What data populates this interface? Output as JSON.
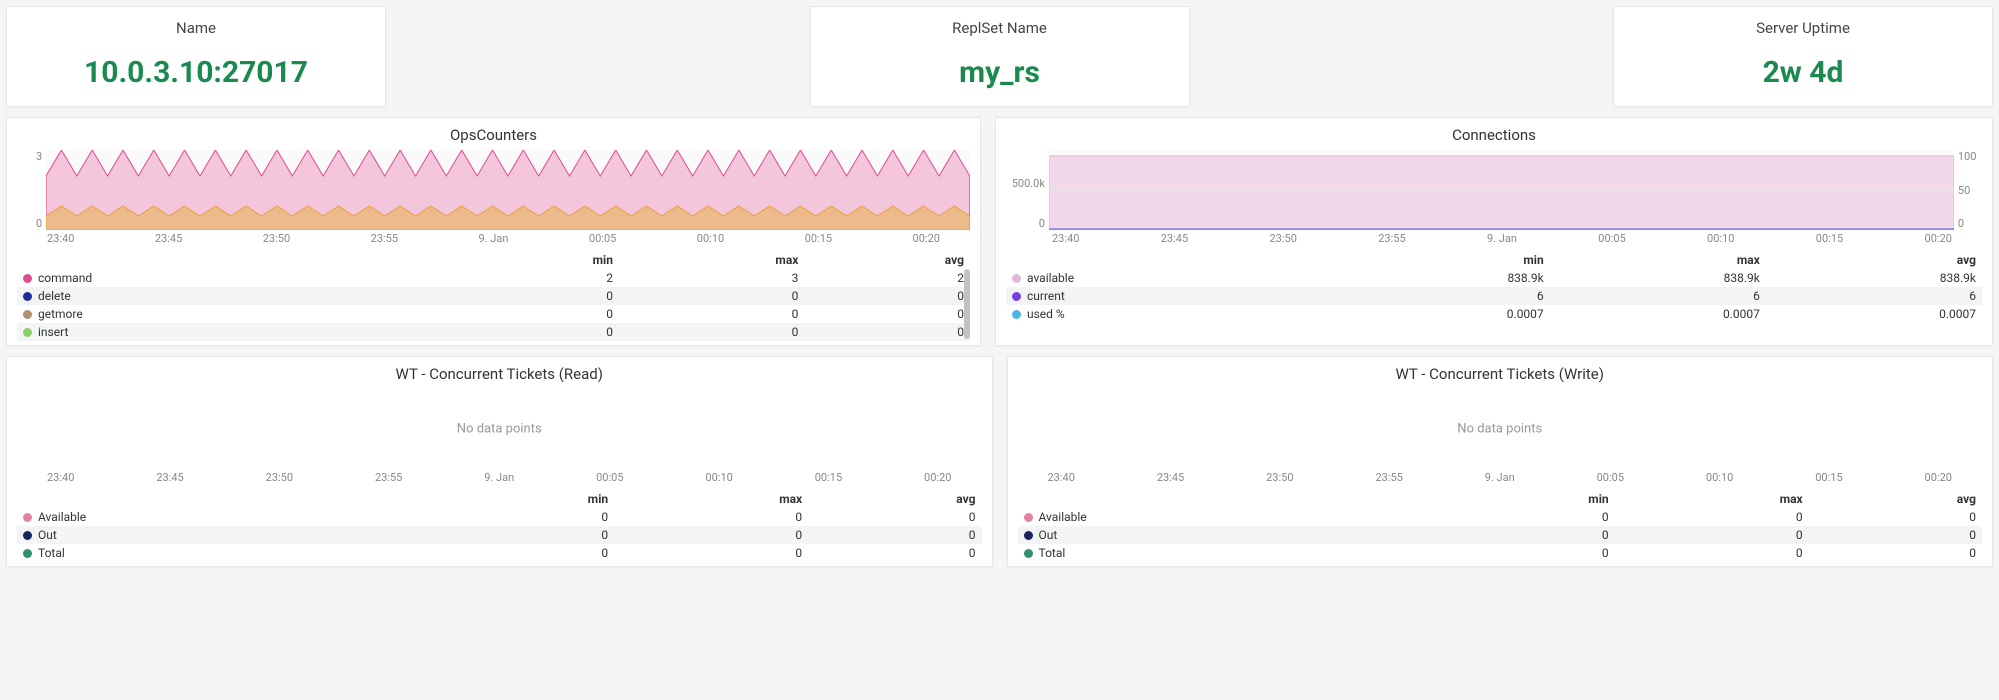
{
  "stats": {
    "name_label": "Name",
    "name_value": "10.0.3.10:27017",
    "replset_label": "ReplSet Name",
    "replset_value": "my_rs",
    "uptime_label": "Server Uptime",
    "uptime_value": "2w 4d"
  },
  "time_ticks": [
    "23:40",
    "23:45",
    "23:50",
    "23:55",
    "9. Jan",
    "00:05",
    "00:10",
    "00:15",
    "00:20"
  ],
  "table_headers": {
    "min": "min",
    "max": "max",
    "avg": "avg"
  },
  "nodata_text": "No data points",
  "panels": {
    "ops": {
      "title": "OpsCounters",
      "y_ticks": [
        "3",
        "0"
      ],
      "legend": [
        {
          "color": "#e24d8e",
          "label": "command",
          "min": "2",
          "max": "3",
          "avg": "2"
        },
        {
          "color": "#1f2f98",
          "label": "delete",
          "min": "0",
          "max": "0",
          "avg": "0"
        },
        {
          "color": "#b08f6f",
          "label": "getmore",
          "min": "0",
          "max": "0",
          "avg": "0"
        },
        {
          "color": "#8bd06b",
          "label": "insert",
          "min": "0",
          "max": "0",
          "avg": "0"
        }
      ]
    },
    "conn": {
      "title": "Connections",
      "y_left": [
        "",
        "500.0k",
        "0"
      ],
      "y_right": [
        "100",
        "50",
        "0"
      ],
      "legend": [
        {
          "color": "#e6b6d6",
          "label": "available",
          "min": "838.9k",
          "max": "838.9k",
          "avg": "838.9k"
        },
        {
          "color": "#7b3fe4",
          "label": "current",
          "min": "6",
          "max": "6",
          "avg": "6"
        },
        {
          "color": "#4fb3e8",
          "label": "used %",
          "min": "0.0007",
          "max": "0.0007",
          "avg": "0.0007"
        }
      ]
    },
    "wt_read": {
      "title": "WT - Concurrent Tickets (Read)",
      "legend": [
        {
          "color": "#e6829f",
          "label": "Available",
          "min": "0",
          "max": "0",
          "avg": "0"
        },
        {
          "color": "#18225e",
          "label": "Out",
          "min": "0",
          "max": "0",
          "avg": "0"
        },
        {
          "color": "#2f8f6f",
          "label": "Total",
          "min": "0",
          "max": "0",
          "avg": "0"
        }
      ]
    },
    "wt_write": {
      "title": "WT - Concurrent Tickets (Write)",
      "legend": [
        {
          "color": "#e6829f",
          "label": "Available",
          "min": "0",
          "max": "0",
          "avg": "0"
        },
        {
          "color": "#18225e",
          "label": "Out",
          "min": "0",
          "max": "0",
          "avg": "0"
        },
        {
          "color": "#2f8f6f",
          "label": "Total",
          "min": "0",
          "max": "0",
          "avg": "0"
        }
      ]
    }
  },
  "chart_data": [
    {
      "type": "area",
      "title": "OpsCounters",
      "xlabel": "",
      "ylabel": "",
      "ylim": [
        0,
        3
      ],
      "x": [
        "23:40",
        "23:45",
        "23:50",
        "23:55",
        "9. Jan",
        "00:05",
        "00:10",
        "00:15",
        "00:20"
      ],
      "series": [
        {
          "name": "command",
          "values_approx": "oscillates between 2 and 3",
          "min": 2,
          "max": 3,
          "avg": 2
        },
        {
          "name": "delete",
          "min": 0,
          "max": 0,
          "avg": 0
        },
        {
          "name": "getmore",
          "min": 0,
          "max": 0,
          "avg": 0
        },
        {
          "name": "insert",
          "min": 0,
          "max": 0,
          "avg": 0
        }
      ]
    },
    {
      "type": "area",
      "title": "Connections",
      "xlabel": "",
      "ylabel": "",
      "ylim_left": [
        0,
        1000000
      ],
      "ylim_right": [
        0,
        100
      ],
      "x": [
        "23:40",
        "23:45",
        "23:50",
        "23:55",
        "9. Jan",
        "00:05",
        "00:10",
        "00:15",
        "00:20"
      ],
      "series": [
        {
          "name": "available",
          "min": 838900,
          "max": 838900,
          "avg": 838900,
          "axis": "left"
        },
        {
          "name": "current",
          "min": 6,
          "max": 6,
          "avg": 6,
          "axis": "left"
        },
        {
          "name": "used %",
          "min": 0.0007,
          "max": 0.0007,
          "avg": 0.0007,
          "axis": "right"
        }
      ]
    },
    {
      "type": "line",
      "title": "WT - Concurrent Tickets (Read)",
      "x": [
        "23:40",
        "23:45",
        "23:50",
        "23:55",
        "9. Jan",
        "00:05",
        "00:10",
        "00:15",
        "00:20"
      ],
      "series": [
        {
          "name": "Available",
          "min": 0,
          "max": 0,
          "avg": 0
        },
        {
          "name": "Out",
          "min": 0,
          "max": 0,
          "avg": 0
        },
        {
          "name": "Total",
          "min": 0,
          "max": 0,
          "avg": 0
        }
      ],
      "note": "No data points"
    },
    {
      "type": "line",
      "title": "WT - Concurrent Tickets (Write)",
      "x": [
        "23:40",
        "23:45",
        "23:50",
        "23:55",
        "9. Jan",
        "00:05",
        "00:10",
        "00:15",
        "00:20"
      ],
      "series": [
        {
          "name": "Available",
          "min": 0,
          "max": 0,
          "avg": 0
        },
        {
          "name": "Out",
          "min": 0,
          "max": 0,
          "avg": 0
        },
        {
          "name": "Total",
          "min": 0,
          "max": 0,
          "avg": 0
        }
      ],
      "note": "No data points"
    }
  ]
}
